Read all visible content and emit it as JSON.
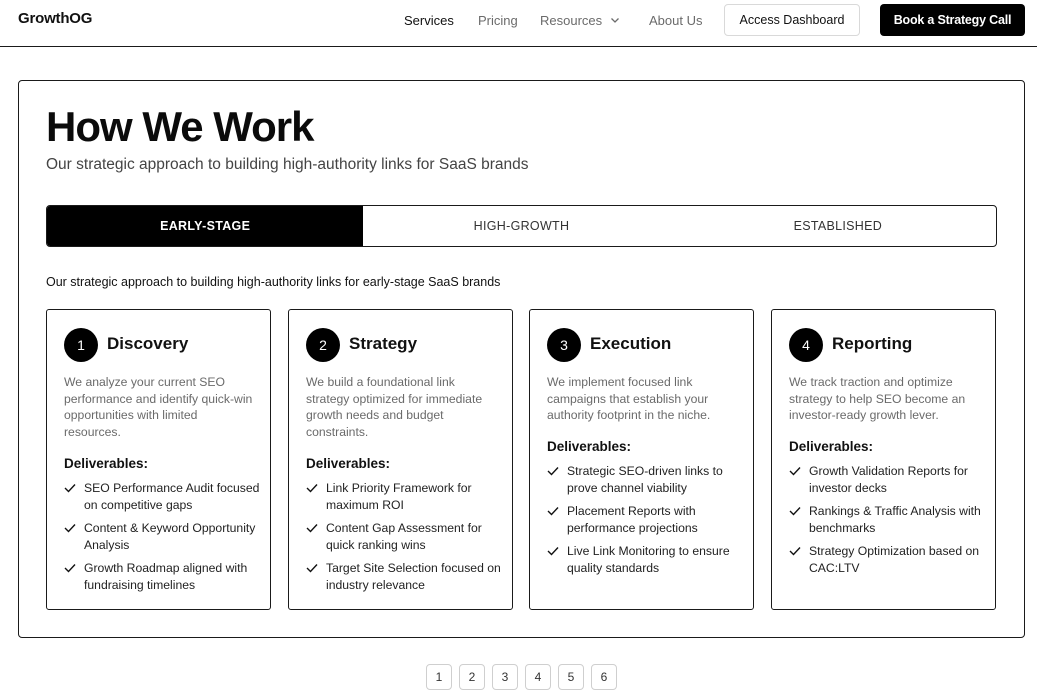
{
  "header": {
    "logo": "GrowthOG",
    "nav": {
      "services": "Services",
      "pricing": "Pricing",
      "resources": "Resources",
      "about": "About Us"
    },
    "access_label": "Access Dashboard",
    "cta_label": "Book a Strategy Call"
  },
  "main": {
    "title": "How We Work",
    "subtitle": "Our strategic approach to building high-authority links for SaaS brands",
    "tabs": [
      "EARLY-STAGE",
      "HIGH-GROWTH",
      "ESTABLISHED"
    ],
    "active_tab": "EARLY-STAGE",
    "tab_description": "Our strategic approach to building high-authority links for early-stage SaaS brands",
    "deliverables_label": "Deliverables:",
    "steps": [
      {
        "number": "1",
        "title": "Discovery",
        "description": "We analyze your current SEO performance and identify quick-win opportunities with limited resources.",
        "deliverables": [
          "SEO Performance Audit focused on competitive gaps",
          "Content & Keyword Opportunity Analysis",
          "Growth Roadmap aligned with fundraising timelines"
        ]
      },
      {
        "number": "2",
        "title": "Strategy",
        "description": "We build a foundational link strategy optimized for immediate growth needs and budget constraints.",
        "deliverables": [
          "Link Priority Framework for maximum ROI",
          "Content Gap Assessment for quick ranking wins",
          "Target Site Selection focused on industry relevance"
        ]
      },
      {
        "number": "3",
        "title": "Execution",
        "description": "We implement focused link campaigns that establish your authority footprint in the niche.",
        "deliverables": [
          "Strategic SEO-driven links to prove channel viability",
          "Placement Reports with performance projections",
          "Live Link Monitoring to ensure quality standards"
        ]
      },
      {
        "number": "4",
        "title": "Reporting",
        "description": "We track traction and optimize strategy to help SEO become an investor-ready growth lever.",
        "deliverables": [
          "Growth Validation Reports for investor decks",
          "Rankings & Traffic Analysis with benchmarks",
          "Strategy Optimization based on CAC:LTV"
        ]
      }
    ]
  },
  "pagination": [
    "1",
    "2",
    "3",
    "4",
    "5",
    "6"
  ]
}
